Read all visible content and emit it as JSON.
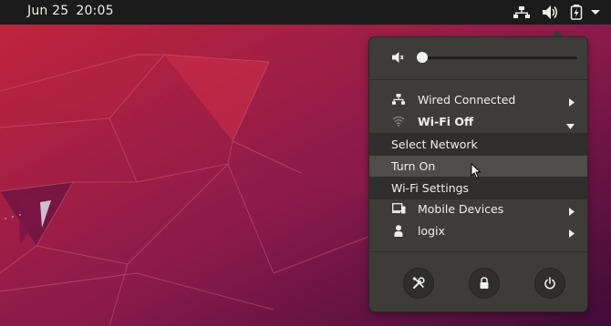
{
  "topbar": {
    "date": "Jun 25",
    "time": "20:05",
    "tray_icons": [
      "network-wired-icon",
      "volume-icon",
      "battery-icon",
      "chevron-down-icon"
    ]
  },
  "menu": {
    "volume_percent": 0,
    "items": [
      {
        "label": "Wired Connected",
        "icon": "network-wired-icon"
      },
      {
        "label": "Wi-Fi Off",
        "icon": "wifi-icon"
      },
      {
        "label": "Mobile Devices",
        "icon": "mobile-devices-icon"
      },
      {
        "label": "logix",
        "icon": "user-icon"
      }
    ],
    "wifi_submenu": [
      {
        "label": "Select Network"
      },
      {
        "label": "Turn On"
      },
      {
        "label": "Wi-Fi Settings"
      }
    ],
    "actions": [
      {
        "name": "settings-icon"
      },
      {
        "name": "lock-icon"
      },
      {
        "name": "power-icon"
      }
    ]
  },
  "colors": {
    "topbar": "#1b1b1b",
    "menu_bg": "#3d3c38",
    "submenu_bg": "#2f2e2c",
    "hover": "#4e4d49",
    "wallpaper_red": "#c4253b",
    "wallpaper_purple": "#4a0e3c"
  }
}
